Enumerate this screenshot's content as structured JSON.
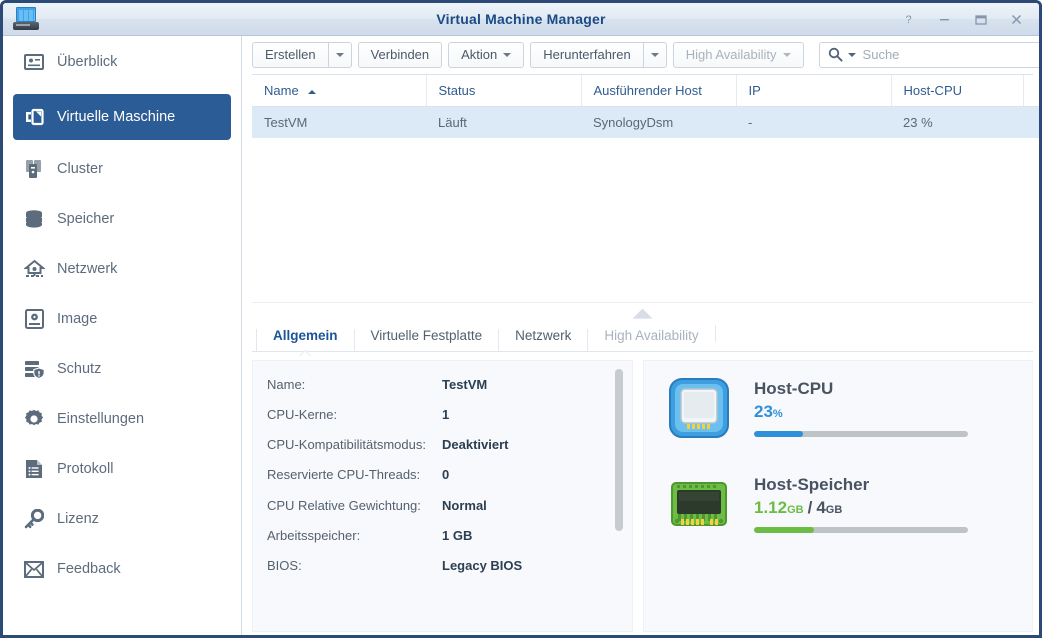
{
  "window": {
    "title": "Virtual Machine Manager",
    "app_icon": "server-rack-icon",
    "controls": [
      {
        "name": "help-button",
        "glyph": "?"
      },
      {
        "name": "minimize-button",
        "glyph": "–"
      },
      {
        "name": "maximize-button",
        "glyph": "□"
      },
      {
        "name": "close-button",
        "glyph": "✕"
      }
    ]
  },
  "sidebar": {
    "items": [
      {
        "label": "Überblick",
        "icon": "overview-icon",
        "active": false
      },
      {
        "label": "Virtuelle Maschine",
        "icon": "virtual-machine-icon",
        "active": true
      },
      {
        "label": "Cluster",
        "icon": "cluster-icon",
        "active": false
      },
      {
        "label": "Speicher",
        "icon": "storage-icon",
        "active": false
      },
      {
        "label": "Netzwerk",
        "icon": "network-icon",
        "active": false
      },
      {
        "label": "Image",
        "icon": "image-icon",
        "active": false
      },
      {
        "label": "Schutz",
        "icon": "protection-icon",
        "active": false
      },
      {
        "label": "Einstellungen",
        "icon": "settings-gear-icon",
        "active": false
      },
      {
        "label": "Protokoll",
        "icon": "log-icon",
        "active": false
      },
      {
        "label": "Lizenz",
        "icon": "license-key-icon",
        "active": false
      },
      {
        "label": "Feedback",
        "icon": "feedback-envelope-icon",
        "active": false
      }
    ]
  },
  "toolbar": {
    "create_label": "Erstellen",
    "connect_label": "Verbinden",
    "action_label": "Aktion",
    "shutdown_label": "Herunterfahren",
    "high_availability_label": "High Availability"
  },
  "search": {
    "placeholder": "Suche",
    "value": ""
  },
  "table": {
    "columns": [
      {
        "label": "Name",
        "sorted": "asc"
      },
      {
        "label": "Status"
      },
      {
        "label": "Ausführender Host"
      },
      {
        "label": "IP"
      },
      {
        "label": "Host-CPU"
      }
    ],
    "rows": [
      {
        "name": "TestVM",
        "status": "Läuft",
        "host": "SynologyDsm",
        "ip": "-",
        "host_cpu": "23 %"
      }
    ]
  },
  "detail": {
    "tabs": [
      {
        "label": "Allgemein",
        "active": true,
        "disabled": false
      },
      {
        "label": "Virtuelle Festplatte",
        "active": false,
        "disabled": false
      },
      {
        "label": "Netzwerk",
        "active": false,
        "disabled": false
      },
      {
        "label": "High Availability",
        "active": false,
        "disabled": true
      }
    ],
    "specs": [
      {
        "key": "Name:",
        "value": "TestVM"
      },
      {
        "key": "CPU-Kerne:",
        "value": "1"
      },
      {
        "key": "CPU-Kompatibilitätsmodus:",
        "value": "Deaktiviert"
      },
      {
        "key": "Reservierte CPU-Threads:",
        "value": "0"
      },
      {
        "key": "CPU Relative Gewichtung:",
        "value": "Normal"
      },
      {
        "key": "Arbeitsspeicher:",
        "value": "1 GB"
      },
      {
        "key": "BIOS:",
        "value": "Legacy BIOS"
      }
    ],
    "meters": [
      {
        "icon": "cpu-chip-icon",
        "title": "Host-CPU",
        "value": "23",
        "unit": "%",
        "percent": 23,
        "color": "#2e90d8"
      },
      {
        "icon": "memory-module-icon",
        "title": "Host-Speicher",
        "value": "1.12",
        "unit": "GB",
        "separator": "/",
        "total": "4",
        "total_unit": "GB",
        "percent": 28,
        "color": "#6dbd45"
      }
    ]
  },
  "colors": {
    "accent": "#2b5c96",
    "title_text": "#1b4a85",
    "status_running": "#5aa02c",
    "row_selected": "#dceaf7",
    "cpu_blue": "#2e90d8",
    "mem_green": "#6dbd45"
  }
}
